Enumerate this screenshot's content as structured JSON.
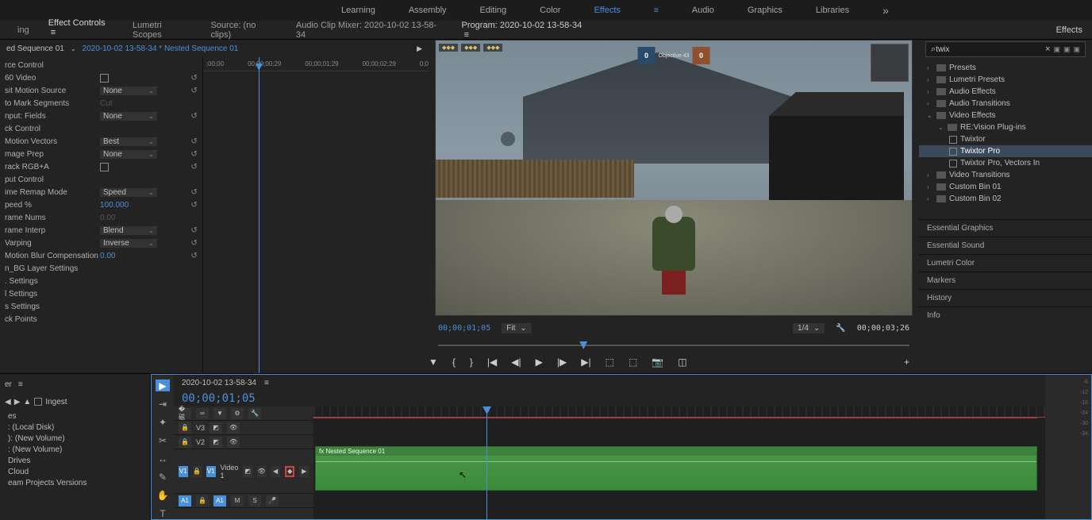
{
  "topmenu": {
    "learning": "Learning",
    "assembly": "Assembly",
    "editing": "Editing",
    "color": "Color",
    "effects": "Effects",
    "audio": "Audio",
    "graphics": "Graphics",
    "libraries": "Libraries"
  },
  "subtabs": {
    "ing": "ing",
    "effect_controls": "Effect Controls",
    "lumetri_scopes": "Lumetri Scopes",
    "source": "Source: (no clips)",
    "audio_mixer": "Audio Clip Mixer: 2020-10-02 13-58-34"
  },
  "breadcrumb": {
    "seq": "ed Sequence 01",
    "clip": "2020-10-02 13-58-34 * Nested Sequence 01"
  },
  "props": {
    "rows": [
      {
        "n": "rce Control",
        "t": "label"
      },
      {
        "n": "60 Video",
        "t": "chk"
      },
      {
        "n": "sit Motion Source",
        "v": "None",
        "t": "dd"
      },
      {
        "n": "to Mark Segments",
        "v": "Cut",
        "t": "dim"
      },
      {
        "n": "nput: Fields",
        "v": "None",
        "t": "dd"
      },
      {
        "n": "ck Control",
        "t": "label"
      },
      {
        "n": "Motion Vectors",
        "v": "Best",
        "t": "dd"
      },
      {
        "n": "mage Prep",
        "v": "None",
        "t": "dd"
      },
      {
        "n": "rack RGB+A",
        "t": "chk"
      },
      {
        "n": "put Control",
        "t": "label"
      },
      {
        "n": "ime Remap Mode",
        "v": "Speed",
        "t": "dd"
      },
      {
        "n": "peed %",
        "v": "100.000",
        "t": "val"
      },
      {
        "n": "rame Nums",
        "v": "0.00",
        "t": "dim"
      },
      {
        "n": "rame Interp",
        "v": "Blend",
        "t": "dd"
      },
      {
        "n": "Varping",
        "v": "Inverse",
        "t": "dd"
      },
      {
        "n": "Motion Blur Compensation",
        "v": "0.00",
        "t": "val"
      },
      {
        "n": "n_BG Layer Settings",
        "t": "label"
      },
      {
        "n": ". Settings",
        "t": "label"
      },
      {
        "n": "l Settings",
        "t": "label"
      },
      {
        "n": "s Settings",
        "t": "label"
      },
      {
        "n": "ck Points",
        "t": "label"
      }
    ],
    "ruler": [
      ":00;00",
      "00;00;00;29",
      "00;00;01;29",
      "00;00;02;29",
      "0;0"
    ]
  },
  "program": {
    "title": "Program: 2020-10-02 13-58-34",
    "tc": "00;00;01;05",
    "fit": "Fit",
    "res": "1/4",
    "dur": "00;00;03;26",
    "score_blue": "0",
    "score_orange": "0",
    "score_label": "Objective 43"
  },
  "effects": {
    "title": "Effects",
    "search": "twix",
    "tree": [
      {
        "l": "Presets",
        "d": 0,
        "exp": ">"
      },
      {
        "l": "Lumetri Presets",
        "d": 0,
        "exp": ">"
      },
      {
        "l": "Audio Effects",
        "d": 0,
        "exp": ">"
      },
      {
        "l": "Audio Transitions",
        "d": 0,
        "exp": ">"
      },
      {
        "l": "Video Effects",
        "d": 0,
        "exp": "v"
      },
      {
        "l": "RE:Vision Plug-ins",
        "d": 1,
        "exp": "v"
      },
      {
        "l": "Twixtor",
        "d": 2,
        "leaf": true
      },
      {
        "l": "Twixtor Pro",
        "d": 2,
        "leaf": true,
        "sel": true
      },
      {
        "l": "Twixtor Pro, Vectors In",
        "d": 2,
        "leaf": true
      },
      {
        "l": "Video Transitions",
        "d": 0,
        "exp": ">"
      },
      {
        "l": "Custom Bin 01",
        "d": 0,
        "exp": ">"
      },
      {
        "l": "Custom Bin 02",
        "d": 0,
        "exp": ">"
      }
    ],
    "subpanels": [
      "Essential Graphics",
      "Essential Sound",
      "Lumetri Color",
      "Markers",
      "History",
      "Info"
    ]
  },
  "project": {
    "ingest": "Ingest",
    "items": [
      "es",
      ": (Local Disk)",
      "): (New Volume)",
      ": (New Volume)",
      "Drives",
      "Cloud",
      "eam Projects Versions"
    ]
  },
  "timeline": {
    "seq_name": "2020-10-02 13-58-34",
    "tc": "00;00;01;05",
    "tracks": {
      "v3": "V3",
      "v2": "V2",
      "v1": "V1",
      "video1": "Video 1",
      "a1": "A1",
      "m": "M",
      "s": "S"
    },
    "clip_label": "fx  Nested Sequence 01",
    "meters": [
      "-6",
      "-12",
      "-18",
      "-24",
      "-30",
      "-34"
    ]
  }
}
